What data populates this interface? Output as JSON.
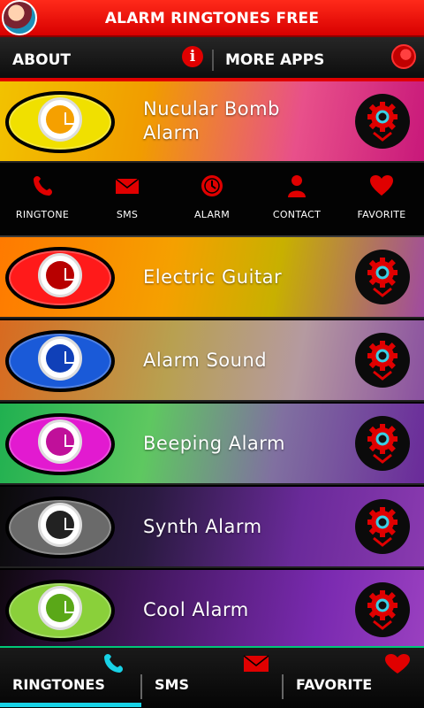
{
  "app": {
    "title": "ALARM RINGTONES FREE",
    "accent_color": "#e00000",
    "avatar_icon": "app-avatar-icon"
  },
  "topnav": {
    "about_label": "ABOUT",
    "more_apps_label": "MORE APPS",
    "info_icon": "info-icon",
    "globe_icon": "globe-icon",
    "info_glyph": "i"
  },
  "actions": [
    {
      "label": "RINGTONE",
      "icon": "phone-icon"
    },
    {
      "label": "SMS",
      "icon": "envelope-icon"
    },
    {
      "label": "ALARM",
      "icon": "alarm-icon"
    },
    {
      "label": "CONTACT",
      "icon": "person-icon"
    },
    {
      "label": "FAVORITE",
      "icon": "heart-icon"
    }
  ],
  "ringtones": [
    {
      "title_line1": "Nucular Bomb",
      "title_line2": "Alarm",
      "color": "#f0e000"
    },
    {
      "title_line1": "Electric Guitar",
      "title_line2": "",
      "color": "#ff1a1a"
    },
    {
      "title_line1": "Alarm Sound",
      "title_line2": "",
      "color": "#1a5ad8"
    },
    {
      "title_line1": "Beeping Alarm",
      "title_line2": "",
      "color": "#e21ad0"
    },
    {
      "title_line1": "Synth Alarm",
      "title_line2": "",
      "color": "#6a6a6a"
    },
    {
      "title_line1": "Cool Alarm",
      "title_line2": "",
      "color": "#8ad03a"
    }
  ],
  "bottomnav": {
    "tabs": [
      {
        "label": "RINGTONES",
        "icon": "phone-icon",
        "icon_color": "#18d2e6",
        "active": true
      },
      {
        "label": "SMS",
        "icon": "envelope-icon",
        "icon_color": "#e00000",
        "active": false
      },
      {
        "label": "FAVORITE",
        "icon": "heart-icon",
        "icon_color": "#e00000",
        "active": false
      }
    ],
    "active_color": "#18d2e6",
    "border_color": "#00c878"
  }
}
